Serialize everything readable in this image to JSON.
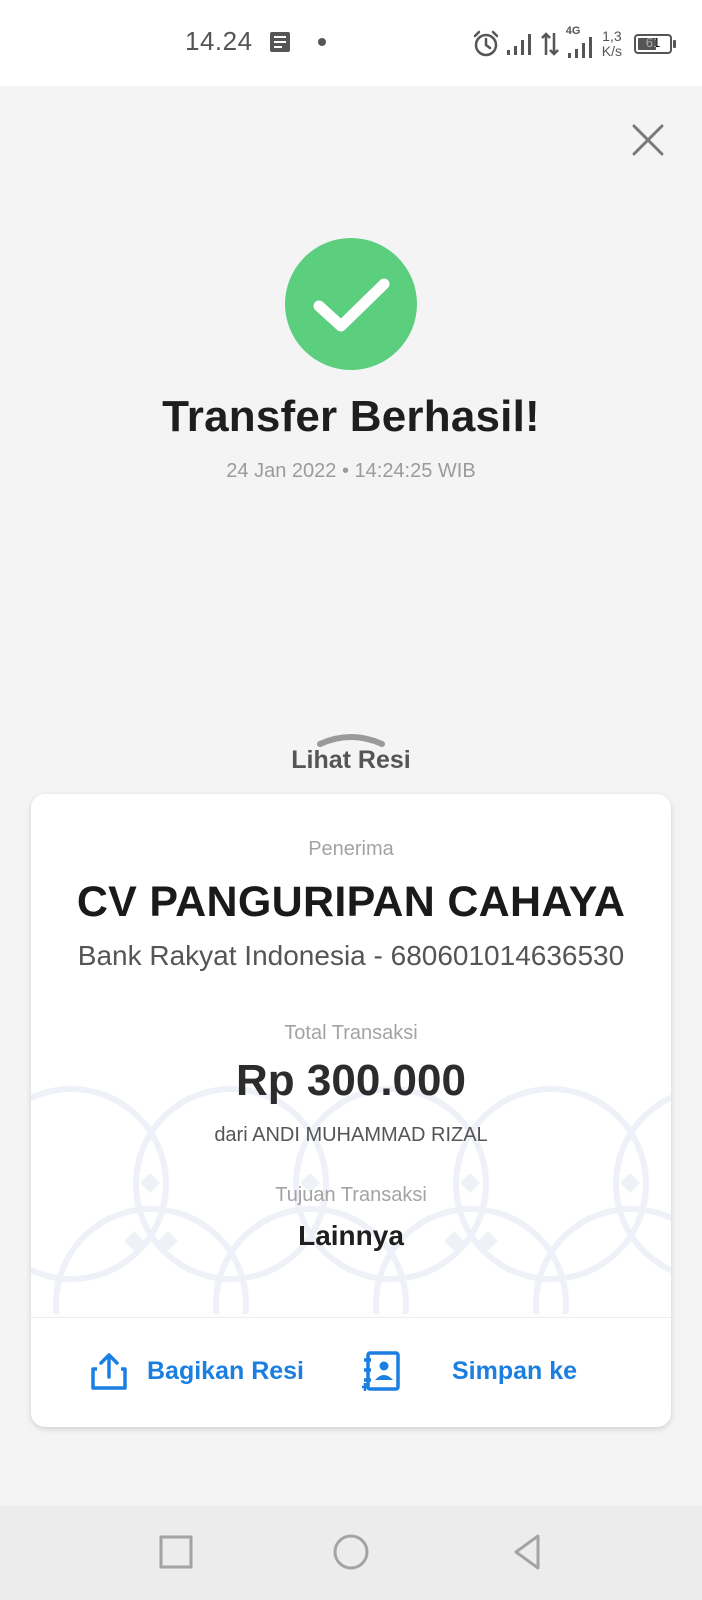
{
  "status_bar": {
    "time": "14.24",
    "speed": "1,3",
    "speed_unit": "K/s",
    "network_type": "4G",
    "battery": "61",
    "battery_level": 0.61,
    "icons": [
      "notes-icon",
      "alarm-icon",
      "signal-icon",
      "data-transfer-icon",
      "signal-4g-icon",
      "battery-icon"
    ]
  },
  "header": {
    "close_icon": "close-icon"
  },
  "result": {
    "status_icon": "check-circle-icon",
    "status_color": "#5bcf7e",
    "title": "Transfer Berhasil!",
    "timestamp": "24 Jan 2022 • 14:24:25 WIB"
  },
  "receipt_toggle": {
    "icon": "chevron-up-icon",
    "label": "Lihat Resi"
  },
  "receipt": {
    "recipient_label": "Penerima",
    "recipient_name": "CV PANGURIPAN CAHAYA",
    "recipient_bank": "Bank Rakyat Indonesia - 680601014636530",
    "total_label": "Total Transaksi",
    "total_amount": "Rp 300.000",
    "sender": "dari ANDI MUHAMMAD RIZAL",
    "purpose_label": "Tujuan Transaksi",
    "purpose_value": "Lainnya"
  },
  "actions": {
    "share": {
      "label": "Bagikan Resi",
      "icon": "share-icon"
    },
    "save": {
      "label": "Simpan ke",
      "icon": "contact-save-icon"
    },
    "accent_color": "#1a7fe0"
  },
  "nav": {
    "buttons": [
      "recents-icon",
      "home-icon",
      "back-icon"
    ]
  }
}
